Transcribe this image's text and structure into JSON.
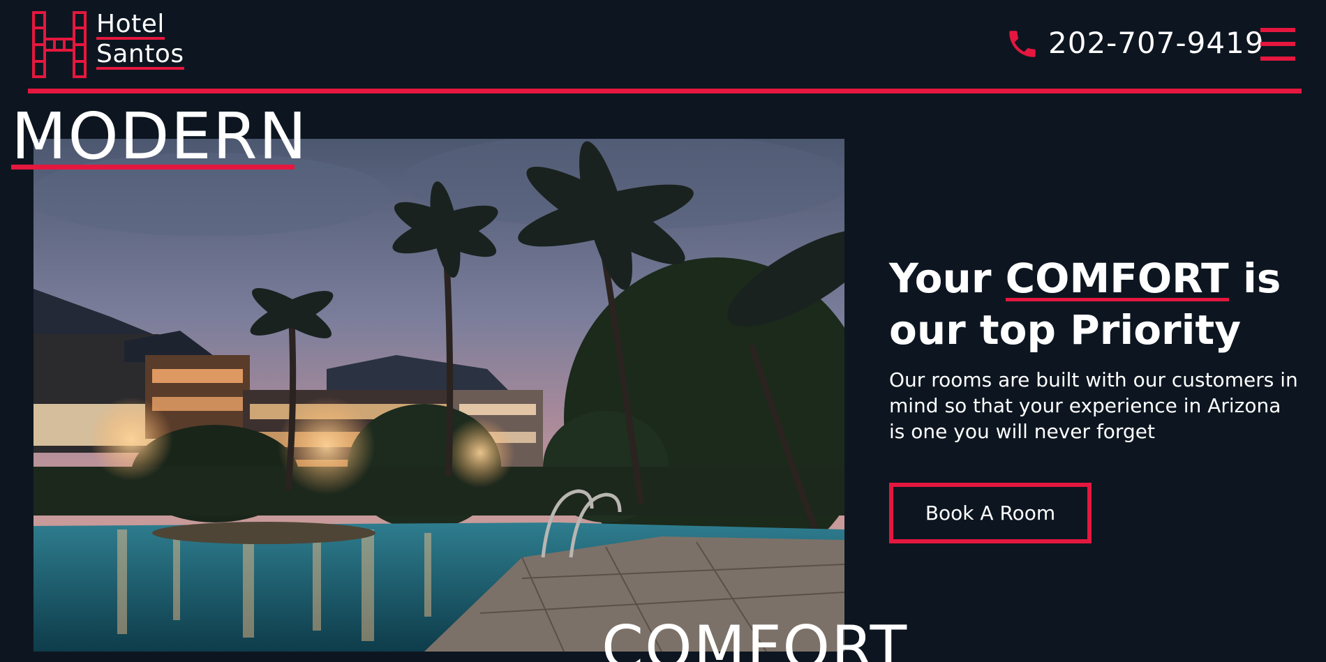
{
  "brand": {
    "name_line1": "Hotel",
    "name_line2": "Santos",
    "logo_icon": "hotel-h-logo-icon",
    "accent_color": "#e5173f",
    "background_color": "#0d1620"
  },
  "header": {
    "phone_icon": "phone-icon",
    "phone_number": "202-707-9419",
    "menu_icon": "hamburger-menu-icon"
  },
  "hero": {
    "modern_word": "MODERN",
    "comfort_word": "COMFORT",
    "image_description_icon": "resort-pool-night-photo"
  },
  "intro": {
    "headline_pre": "Your ",
    "headline_accent": "COMFORT",
    "headline_post": " is our top Priority",
    "body": "Our rooms are built with our customers in mind so that your experience in Arizona is one you will never forget",
    "button_label": "Book A Room"
  }
}
